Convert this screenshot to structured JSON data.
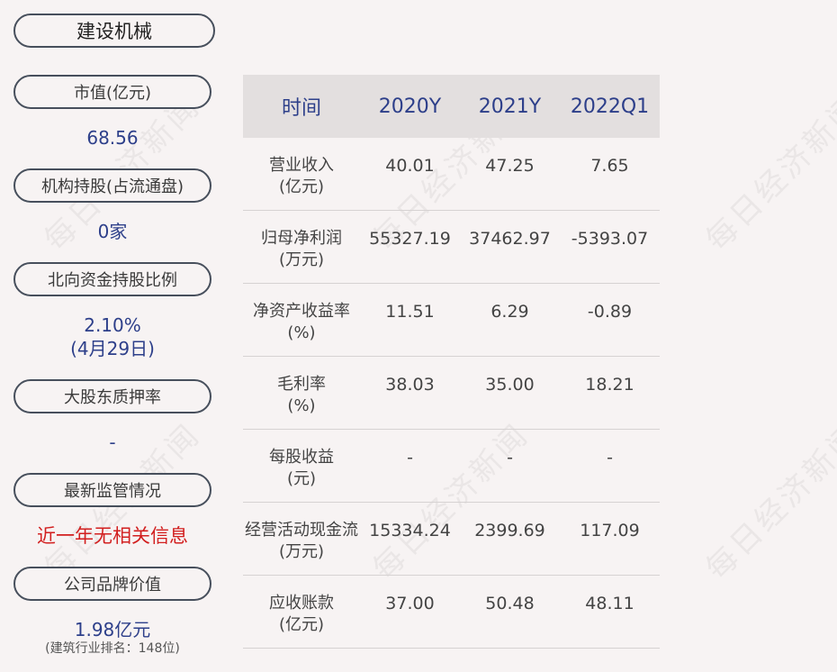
{
  "company": "建设机械",
  "left_panel": {
    "market_cap_label": "市值(亿元)",
    "market_cap_value": "68.56",
    "institution_label": "机构持股(占流通盘)",
    "institution_value": "0家",
    "northbound_label": "北向资金持股比例",
    "northbound_value": "2.10%",
    "northbound_date": "(4月29日)",
    "pledge_label": "大股东质押率",
    "pledge_value": "-",
    "regulation_label": "最新监管情况",
    "regulation_value": "近一年无相关信息",
    "brand_label": "公司品牌价值",
    "brand_value": "1.98亿元",
    "brand_rank": "(建筑行业排名：148位)"
  },
  "table": {
    "headers": [
      "时间",
      "2020Y",
      "2021Y",
      "2022Q1"
    ],
    "rows": [
      {
        "label1": "营业收入",
        "label2": "(亿元)",
        "values": [
          "40.01",
          "47.25",
          "7.65"
        ]
      },
      {
        "label1": "归母净利润",
        "label2": "(万元)",
        "values": [
          "55327.19",
          "37462.97",
          "-5393.07"
        ]
      },
      {
        "label1": "净资产收益率",
        "label2": "(%)",
        "values": [
          "11.51",
          "6.29",
          "-0.89"
        ]
      },
      {
        "label1": "毛利率",
        "label2": "(%)",
        "values": [
          "38.03",
          "35.00",
          "18.21"
        ]
      },
      {
        "label1": "每股收益",
        "label2": "(元)",
        "values": [
          "-",
          "-",
          "-"
        ]
      },
      {
        "label1": "经营活动现金流",
        "label2": "(万元)",
        "values": [
          "15334.24",
          "2399.69",
          "117.09"
        ]
      },
      {
        "label1": "应收账款",
        "label2": "(亿元)",
        "values": [
          "37.00",
          "50.48",
          "48.11"
        ]
      }
    ]
  },
  "watermark_text": "每日经济新闻"
}
